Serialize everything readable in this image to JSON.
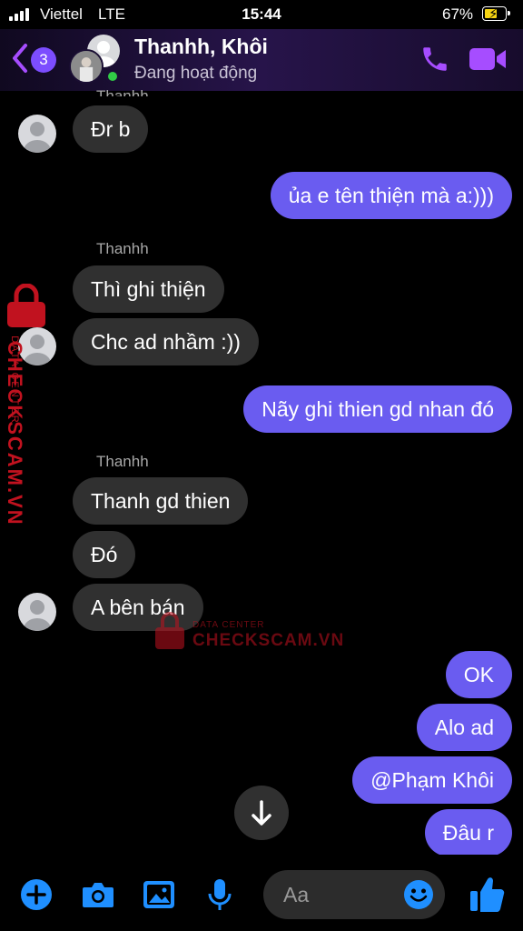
{
  "status_bar": {
    "carrier": "Viettel",
    "network": "LTE",
    "time": "15:44",
    "battery": "67%",
    "battery_level": 0.67
  },
  "header": {
    "unread_count": "3",
    "title": "Thanhh, Khôi",
    "subtitle": "Đang hoạt động",
    "accent_color": "#a64dff"
  },
  "messages": [
    {
      "side": "in",
      "text": "Đr b"
    },
    {
      "side": "out",
      "text": "ủa e tên thiện mà a:)))"
    },
    {
      "side": "in",
      "sender": "Thanhh",
      "text": "Thì ghi thiện"
    },
    {
      "side": "in",
      "text": "Chc ad nhầm :))"
    },
    {
      "side": "out",
      "text": "Nãy ghi thien gd nhan đó"
    },
    {
      "side": "in",
      "sender": "Thanhh",
      "text": "Thanh gd thien"
    },
    {
      "side": "in",
      "text": "Đó"
    },
    {
      "side": "in",
      "text": "A bên bán"
    },
    {
      "side": "out",
      "text": "OK"
    },
    {
      "side": "out",
      "text": "Alo ad"
    },
    {
      "side": "out",
      "text": "@Phạm Khôi"
    },
    {
      "side": "out",
      "text": "Đâu r"
    }
  ],
  "top_sender_partial": "Thanhh",
  "watermark": {
    "small": "DATA CENTER",
    "big": "CHECKSCAM.VN",
    "color": "#c1121f"
  },
  "composer": {
    "placeholder": "Aa",
    "accent_color": "#1f8fff"
  }
}
